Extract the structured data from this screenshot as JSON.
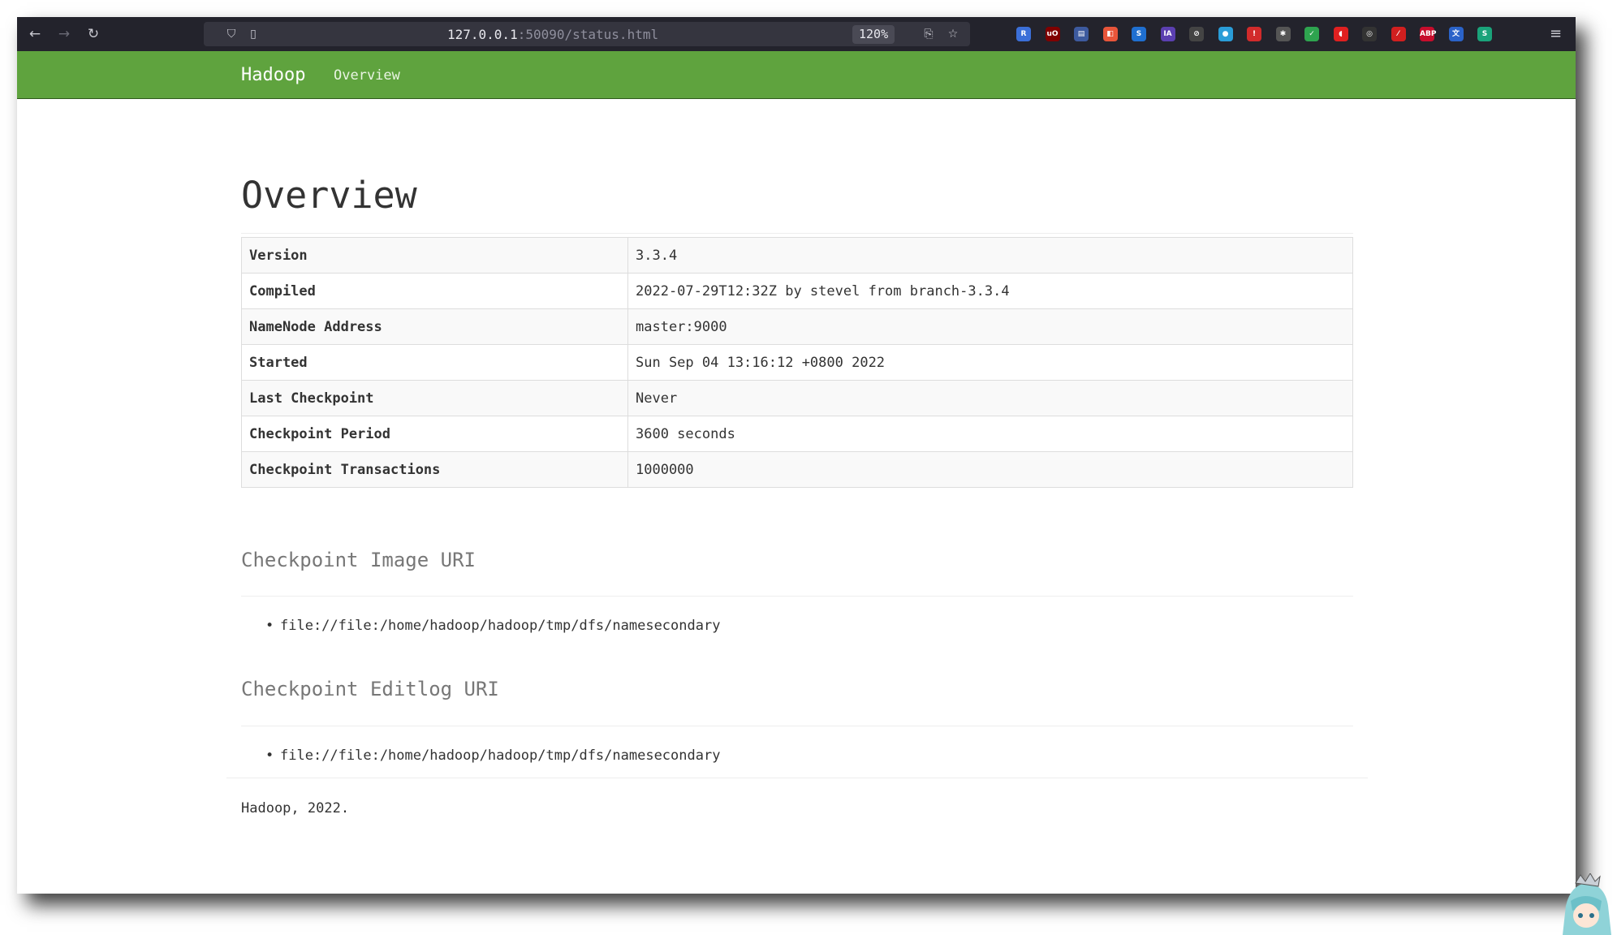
{
  "browser": {
    "url_host": "127.0.0.1",
    "url_rest": ":50090/status.html",
    "zoom": "120%"
  },
  "navbar": {
    "brand": "Hadoop",
    "link_overview": "Overview"
  },
  "page": {
    "title": "Overview",
    "info_rows": [
      {
        "key": "Version",
        "value": "3.3.4"
      },
      {
        "key": "Compiled",
        "value": "2022-07-29T12:32Z by stevel from branch-3.3.4"
      },
      {
        "key": "NameNode Address",
        "value": "master:9000"
      },
      {
        "key": "Started",
        "value": "Sun Sep 04 13:16:12 +0800 2022"
      },
      {
        "key": "Last Checkpoint",
        "value": "Never"
      },
      {
        "key": "Checkpoint Period",
        "value": "3600 seconds"
      },
      {
        "key": "Checkpoint Transactions",
        "value": "1000000"
      }
    ],
    "image_uri_heading": "Checkpoint Image URI",
    "image_uris": [
      "file://file:/home/hadoop/hadoop/tmp/dfs/namesecondary"
    ],
    "editlog_uri_heading": "Checkpoint Editlog URI",
    "editlog_uris": [
      "file://file:/home/hadoop/hadoop/tmp/dfs/namesecondary"
    ],
    "footer": "Hadoop, 2022."
  },
  "extensions": [
    {
      "name": "r-ext-icon",
      "glyph": "R",
      "color": "#3b6fd8"
    },
    {
      "name": "ublock-icon",
      "glyph": "uO",
      "color": "#800000"
    },
    {
      "name": "tab-ext-icon",
      "glyph": "▤",
      "color": "#3d5a9e"
    },
    {
      "name": "pdf-ext-icon",
      "glyph": "◧",
      "color": "#e8553a"
    },
    {
      "name": "s-ext-icon",
      "glyph": "S",
      "color": "#1f6fd0"
    },
    {
      "name": "ia-ext-icon",
      "glyph": "IA",
      "color": "#5b3fb0"
    },
    {
      "name": "compass-ext-icon",
      "glyph": "⊘",
      "color": "#444444"
    },
    {
      "name": "globe-ext-icon",
      "glyph": "●",
      "color": "#2a9dd8"
    },
    {
      "name": "alert-ext-icon",
      "glyph": "!",
      "color": "#d22b2b"
    },
    {
      "name": "puzzle-ext-icon",
      "glyph": "✱",
      "color": "#555555"
    },
    {
      "name": "shield-ext-icon",
      "glyph": "✓",
      "color": "#2ea44f"
    },
    {
      "name": "drop-ext-icon",
      "glyph": "◖",
      "color": "#e02020"
    },
    {
      "name": "glasses-ext-icon",
      "glyph": "◎",
      "color": "#333333"
    },
    {
      "name": "slash-ext-icon",
      "glyph": "⁄",
      "color": "#d11f1f"
    },
    {
      "name": "abp-ext-icon",
      "glyph": "ABP",
      "color": "#c70d2c"
    },
    {
      "name": "translate-ext-icon",
      "glyph": "文",
      "color": "#2b63c9"
    },
    {
      "name": "s-square-ext-icon",
      "glyph": "S",
      "color": "#1aa37a"
    }
  ]
}
